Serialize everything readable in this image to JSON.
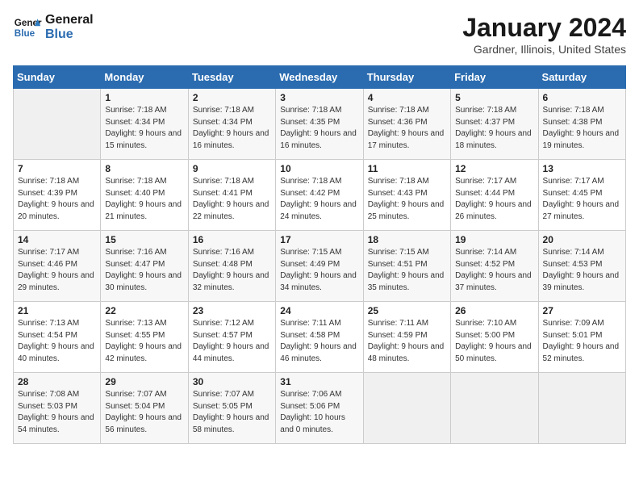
{
  "header": {
    "logo_line1": "General",
    "logo_line2": "Blue",
    "month": "January 2024",
    "location": "Gardner, Illinois, United States"
  },
  "weekdays": [
    "Sunday",
    "Monday",
    "Tuesday",
    "Wednesday",
    "Thursday",
    "Friday",
    "Saturday"
  ],
  "weeks": [
    [
      {
        "day": "",
        "sunrise": "",
        "sunset": "",
        "daylight": ""
      },
      {
        "day": "1",
        "sunrise": "Sunrise: 7:18 AM",
        "sunset": "Sunset: 4:34 PM",
        "daylight": "Daylight: 9 hours and 15 minutes."
      },
      {
        "day": "2",
        "sunrise": "Sunrise: 7:18 AM",
        "sunset": "Sunset: 4:34 PM",
        "daylight": "Daylight: 9 hours and 16 minutes."
      },
      {
        "day": "3",
        "sunrise": "Sunrise: 7:18 AM",
        "sunset": "Sunset: 4:35 PM",
        "daylight": "Daylight: 9 hours and 16 minutes."
      },
      {
        "day": "4",
        "sunrise": "Sunrise: 7:18 AM",
        "sunset": "Sunset: 4:36 PM",
        "daylight": "Daylight: 9 hours and 17 minutes."
      },
      {
        "day": "5",
        "sunrise": "Sunrise: 7:18 AM",
        "sunset": "Sunset: 4:37 PM",
        "daylight": "Daylight: 9 hours and 18 minutes."
      },
      {
        "day": "6",
        "sunrise": "Sunrise: 7:18 AM",
        "sunset": "Sunset: 4:38 PM",
        "daylight": "Daylight: 9 hours and 19 minutes."
      }
    ],
    [
      {
        "day": "7",
        "sunrise": "Sunrise: 7:18 AM",
        "sunset": "Sunset: 4:39 PM",
        "daylight": "Daylight: 9 hours and 20 minutes."
      },
      {
        "day": "8",
        "sunrise": "Sunrise: 7:18 AM",
        "sunset": "Sunset: 4:40 PM",
        "daylight": "Daylight: 9 hours and 21 minutes."
      },
      {
        "day": "9",
        "sunrise": "Sunrise: 7:18 AM",
        "sunset": "Sunset: 4:41 PM",
        "daylight": "Daylight: 9 hours and 22 minutes."
      },
      {
        "day": "10",
        "sunrise": "Sunrise: 7:18 AM",
        "sunset": "Sunset: 4:42 PM",
        "daylight": "Daylight: 9 hours and 24 minutes."
      },
      {
        "day": "11",
        "sunrise": "Sunrise: 7:18 AM",
        "sunset": "Sunset: 4:43 PM",
        "daylight": "Daylight: 9 hours and 25 minutes."
      },
      {
        "day": "12",
        "sunrise": "Sunrise: 7:17 AM",
        "sunset": "Sunset: 4:44 PM",
        "daylight": "Daylight: 9 hours and 26 minutes."
      },
      {
        "day": "13",
        "sunrise": "Sunrise: 7:17 AM",
        "sunset": "Sunset: 4:45 PM",
        "daylight": "Daylight: 9 hours and 27 minutes."
      }
    ],
    [
      {
        "day": "14",
        "sunrise": "Sunrise: 7:17 AM",
        "sunset": "Sunset: 4:46 PM",
        "daylight": "Daylight: 9 hours and 29 minutes."
      },
      {
        "day": "15",
        "sunrise": "Sunrise: 7:16 AM",
        "sunset": "Sunset: 4:47 PM",
        "daylight": "Daylight: 9 hours and 30 minutes."
      },
      {
        "day": "16",
        "sunrise": "Sunrise: 7:16 AM",
        "sunset": "Sunset: 4:48 PM",
        "daylight": "Daylight: 9 hours and 32 minutes."
      },
      {
        "day": "17",
        "sunrise": "Sunrise: 7:15 AM",
        "sunset": "Sunset: 4:49 PM",
        "daylight": "Daylight: 9 hours and 34 minutes."
      },
      {
        "day": "18",
        "sunrise": "Sunrise: 7:15 AM",
        "sunset": "Sunset: 4:51 PM",
        "daylight": "Daylight: 9 hours and 35 minutes."
      },
      {
        "day": "19",
        "sunrise": "Sunrise: 7:14 AM",
        "sunset": "Sunset: 4:52 PM",
        "daylight": "Daylight: 9 hours and 37 minutes."
      },
      {
        "day": "20",
        "sunrise": "Sunrise: 7:14 AM",
        "sunset": "Sunset: 4:53 PM",
        "daylight": "Daylight: 9 hours and 39 minutes."
      }
    ],
    [
      {
        "day": "21",
        "sunrise": "Sunrise: 7:13 AM",
        "sunset": "Sunset: 4:54 PM",
        "daylight": "Daylight: 9 hours and 40 minutes."
      },
      {
        "day": "22",
        "sunrise": "Sunrise: 7:13 AM",
        "sunset": "Sunset: 4:55 PM",
        "daylight": "Daylight: 9 hours and 42 minutes."
      },
      {
        "day": "23",
        "sunrise": "Sunrise: 7:12 AM",
        "sunset": "Sunset: 4:57 PM",
        "daylight": "Daylight: 9 hours and 44 minutes."
      },
      {
        "day": "24",
        "sunrise": "Sunrise: 7:11 AM",
        "sunset": "Sunset: 4:58 PM",
        "daylight": "Daylight: 9 hours and 46 minutes."
      },
      {
        "day": "25",
        "sunrise": "Sunrise: 7:11 AM",
        "sunset": "Sunset: 4:59 PM",
        "daylight": "Daylight: 9 hours and 48 minutes."
      },
      {
        "day": "26",
        "sunrise": "Sunrise: 7:10 AM",
        "sunset": "Sunset: 5:00 PM",
        "daylight": "Daylight: 9 hours and 50 minutes."
      },
      {
        "day": "27",
        "sunrise": "Sunrise: 7:09 AM",
        "sunset": "Sunset: 5:01 PM",
        "daylight": "Daylight: 9 hours and 52 minutes."
      }
    ],
    [
      {
        "day": "28",
        "sunrise": "Sunrise: 7:08 AM",
        "sunset": "Sunset: 5:03 PM",
        "daylight": "Daylight: 9 hours and 54 minutes."
      },
      {
        "day": "29",
        "sunrise": "Sunrise: 7:07 AM",
        "sunset": "Sunset: 5:04 PM",
        "daylight": "Daylight: 9 hours and 56 minutes."
      },
      {
        "day": "30",
        "sunrise": "Sunrise: 7:07 AM",
        "sunset": "Sunset: 5:05 PM",
        "daylight": "Daylight: 9 hours and 58 minutes."
      },
      {
        "day": "31",
        "sunrise": "Sunrise: 7:06 AM",
        "sunset": "Sunset: 5:06 PM",
        "daylight": "Daylight: 10 hours and 0 minutes."
      },
      {
        "day": "",
        "sunrise": "",
        "sunset": "",
        "daylight": ""
      },
      {
        "day": "",
        "sunrise": "",
        "sunset": "",
        "daylight": ""
      },
      {
        "day": "",
        "sunrise": "",
        "sunset": "",
        "daylight": ""
      }
    ]
  ]
}
